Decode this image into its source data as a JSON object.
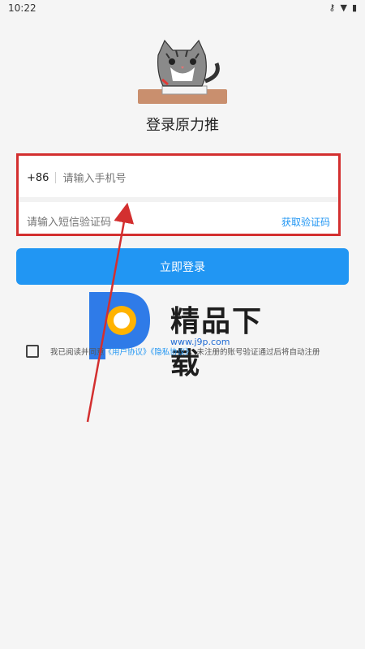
{
  "status": {
    "time": "10:22"
  },
  "app": {
    "title": "登录原力推"
  },
  "login": {
    "country_code": "+86",
    "phone_placeholder": "请输入手机号",
    "code_placeholder": "请输入短信验证码",
    "get_code": "获取验证码",
    "submit": "立即登录"
  },
  "agreement": {
    "prefix": "我已阅读并同意",
    "user_agreement": "《用户协议》",
    "privacy_agreement": "《隐私协议》",
    "suffix": "，未注册的账号验证通过后将自动注册"
  },
  "watermark": {
    "title": "精品下载",
    "url": "www.j9p.com"
  },
  "colors": {
    "accent": "#2196f3",
    "highlight": "#d32f2f"
  },
  "icons": [
    "key-icon",
    "wifi-icon",
    "battery-icon",
    "cat-logo-icon"
  ]
}
